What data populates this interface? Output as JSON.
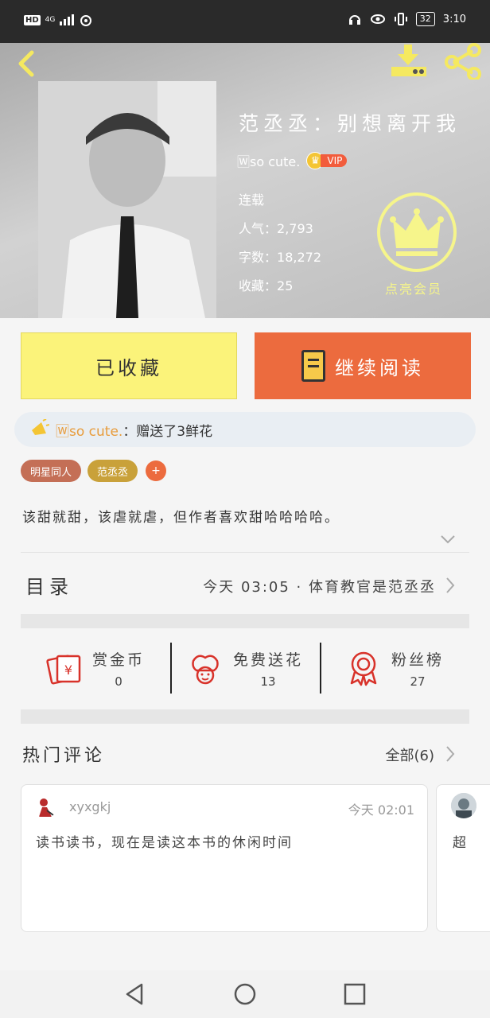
{
  "status_bar": {
    "hd": "HD",
    "network": "4G",
    "battery": "32",
    "time": "3:10"
  },
  "header": {
    "title": "范丞丞：别想离开我",
    "author": "🅆so cute.",
    "vip_label": "VIP",
    "status": "连载",
    "popularity_label": "人气：",
    "popularity_value": "2,793",
    "words_label": "字数：",
    "words_value": "18,272",
    "favorites_label": "收藏：",
    "favorites_value": "25",
    "member_label": "点亮会员"
  },
  "actions": {
    "favorited_label": "已收藏",
    "continue_label": "继续阅读"
  },
  "gift": {
    "user": "🅆so cute.",
    "text": "：赠送了3鲜花"
  },
  "tags": [
    {
      "label": "明星同人",
      "color": "#c46f56"
    },
    {
      "label": "范丞丞",
      "color": "#c9a13a"
    }
  ],
  "tag_add": "+",
  "description": "该甜就甜，该虐就虐，但作者喜欢甜哈哈哈哈。",
  "toc": {
    "label": "目录",
    "latest": "今天 03:05 · 体育教官是范丞丞"
  },
  "stats": [
    {
      "icon": "coin-reward-icon",
      "label": "赏金币",
      "value": "0"
    },
    {
      "icon": "flower-icon",
      "label": "免费送花",
      "value": "13"
    },
    {
      "icon": "fan-badge-icon",
      "label": "粉丝榜",
      "value": "27"
    }
  ],
  "comments": {
    "title": "热门评论",
    "all_label": "全部(6)",
    "items": [
      {
        "user": "xyxgkj",
        "time": "今天 02:01",
        "text": "读书读书，现在是读这本书的休闲时间"
      }
    ],
    "partial_text": "超"
  },
  "colors": {
    "accent_yellow": "#fbf37a",
    "accent_orange": "#ec6b3e",
    "member_yellow": "#f6f58b"
  }
}
